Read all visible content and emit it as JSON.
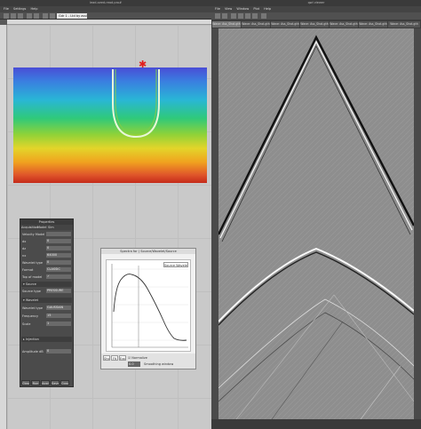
{
  "left_window": {
    "title": "lead-seed-read.pro#",
    "menu": [
      "File",
      "Settings",
      "Help"
    ],
    "zoom_value": "Gdr 1 - Ltd by assignment"
  },
  "properties_panel": {
    "title": "Properties",
    "tabs": [
      "Acquisition",
      "Model",
      "Sim"
    ],
    "rows": [
      {
        "label": "Velocity Model",
        "value": ""
      },
      {
        "label": "dx",
        "value": "0"
      },
      {
        "label": "dz",
        "value": "0"
      },
      {
        "label": "nx",
        "value": "64000"
      },
      {
        "label": "Wavelet type",
        "value": "0"
      },
      {
        "label": "Format",
        "value": "CLASSIC"
      },
      {
        "label": "Top of model",
        "value": "✓"
      }
    ],
    "sections": [
      "Source",
      "Wavelet",
      "Injection"
    ],
    "source_rows": [
      {
        "label": "Source type",
        "value": "PRESSURE"
      }
    ],
    "wavelet_rows": [
      {
        "label": "Wavelet type",
        "value": "GAUSSIAN"
      },
      {
        "label": "Frequency",
        "value": "15"
      },
      {
        "label": "Scale",
        "value": "1"
      }
    ],
    "extra_row": {
      "label": "Amplitude dB",
      "value": "0"
    },
    "buttons": [
      "Close",
      "Run",
      "Apply",
      "Save",
      "Copy"
    ]
  },
  "plot_dialog": {
    "title": "Spectra for ( Source/Wavelet/Source",
    "legend": "Source Wavelet",
    "buttons": [
      "Show",
      "Fit",
      "Export"
    ],
    "checkbox_label": "Normalize",
    "field_label": "Smoothing window",
    "field_value": "0.0",
    "series_color": "#333333",
    "vline_color": "#555555"
  },
  "right_window": {
    "title": "qwl viewer",
    "menu": [
      "File",
      "View",
      "Window",
      "Plot",
      "Help"
    ],
    "tabs": [
      "Wave: Ass_Shot.gth",
      "Wave: Ass_Shot.gth",
      "Wave: Ass_Shot.gth",
      "Wave: Ass_Shot.gth",
      "Wave: Ass_Shot.gth",
      "Wave: Ass_Shot.gth",
      "Wave: Ass_Shot.gth"
    ]
  },
  "colors": {
    "background_dark": "#2a2a2a",
    "panel": "#4b4b4b",
    "marker": "#e21d1d",
    "seismic_gray": "#8e8e8e"
  }
}
